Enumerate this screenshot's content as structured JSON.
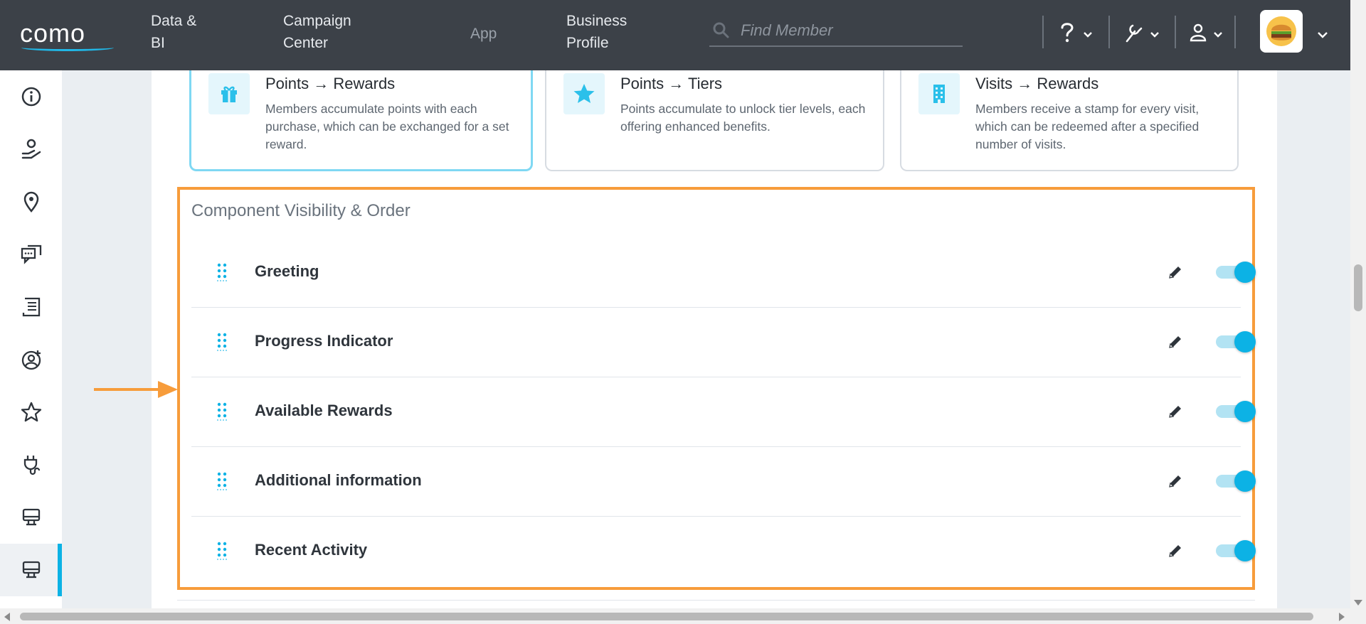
{
  "brand": {
    "logo_text": "como",
    "accent": "#0cb2e5",
    "highlight": "#f79c3b"
  },
  "topnav": {
    "items": [
      {
        "label_line1": "Data &",
        "label_line2": "BI"
      },
      {
        "label_line1": "Campaign",
        "label_line2": "Center"
      },
      {
        "label": "App"
      },
      {
        "label_line1": "Business",
        "label_line2": "Profile"
      }
    ],
    "search": {
      "placeholder": "Find Member",
      "value": ""
    },
    "tools": [
      "help-icon",
      "wrench-icon",
      "user-icon"
    ],
    "avatar": "business-logo-burger"
  },
  "sidebar": {
    "items": [
      {
        "icon": "info-icon"
      },
      {
        "icon": "hand-user-icon"
      },
      {
        "icon": "location-pin-icon"
      },
      {
        "icon": "chat-icon"
      },
      {
        "icon": "receipt-icon"
      },
      {
        "icon": "user-circle-add-icon"
      },
      {
        "icon": "star-icon"
      },
      {
        "icon": "plug-icon"
      },
      {
        "icon": "monitor-icon"
      },
      {
        "icon": "monitor-icon",
        "active": true
      }
    ]
  },
  "cards": [
    {
      "title": "Points → Rewards",
      "description": "Members accumulate points with each purchase, which can be exchanged for a set reward.",
      "icon": "gift-icon",
      "selected": true
    },
    {
      "title": "Points → Tiers",
      "description": "Points accumulate to unlock tier levels, each offering enhanced benefits.",
      "icon": "star-icon",
      "selected": false
    },
    {
      "title": "Visits → Rewards",
      "description": "Members receive a stamp for every visit, which can be redeemed after a specified number of visits.",
      "icon": "building-icon",
      "selected": false
    }
  ],
  "section": {
    "title": "Component Visibility & Order",
    "components": [
      {
        "label": "Greeting",
        "enabled": true
      },
      {
        "label": "Progress Indicator",
        "enabled": true
      },
      {
        "label": "Available Rewards",
        "enabled": true
      },
      {
        "label": "Additional information",
        "enabled": true
      },
      {
        "label": "Recent Activity",
        "enabled": true
      }
    ]
  }
}
